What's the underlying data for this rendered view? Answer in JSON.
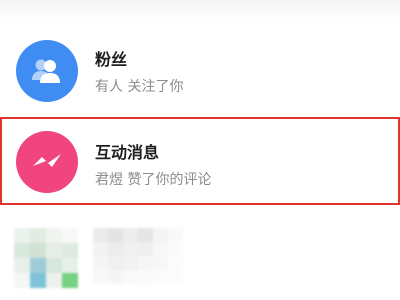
{
  "notifications": [
    {
      "title": "粉丝",
      "subtitle": "有人 关注了你",
      "icon": "group-people-icon",
      "color": "#3f8df3"
    },
    {
      "title": "互动消息",
      "subtitle": "君煜 赞了你的评论",
      "icon": "message-zigzag-icon",
      "color": "#f0457f",
      "highlighted": true,
      "highlight_color": "#e0342e"
    }
  ]
}
